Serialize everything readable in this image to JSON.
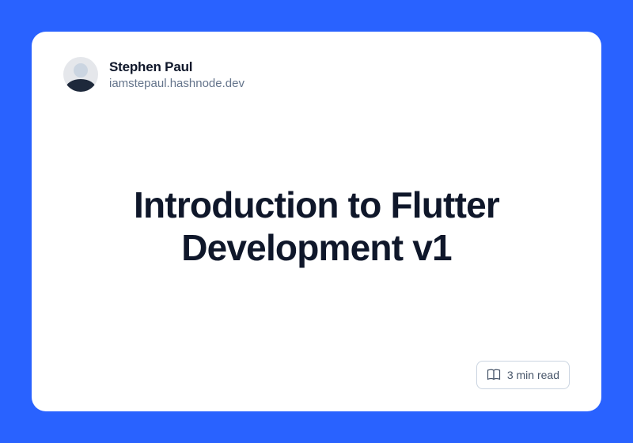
{
  "author": {
    "name": "Stephen Paul",
    "domain": "iamstepaul.hashnode.dev"
  },
  "title": "Introduction to Flutter Development v1",
  "read_time": "3 min read"
}
